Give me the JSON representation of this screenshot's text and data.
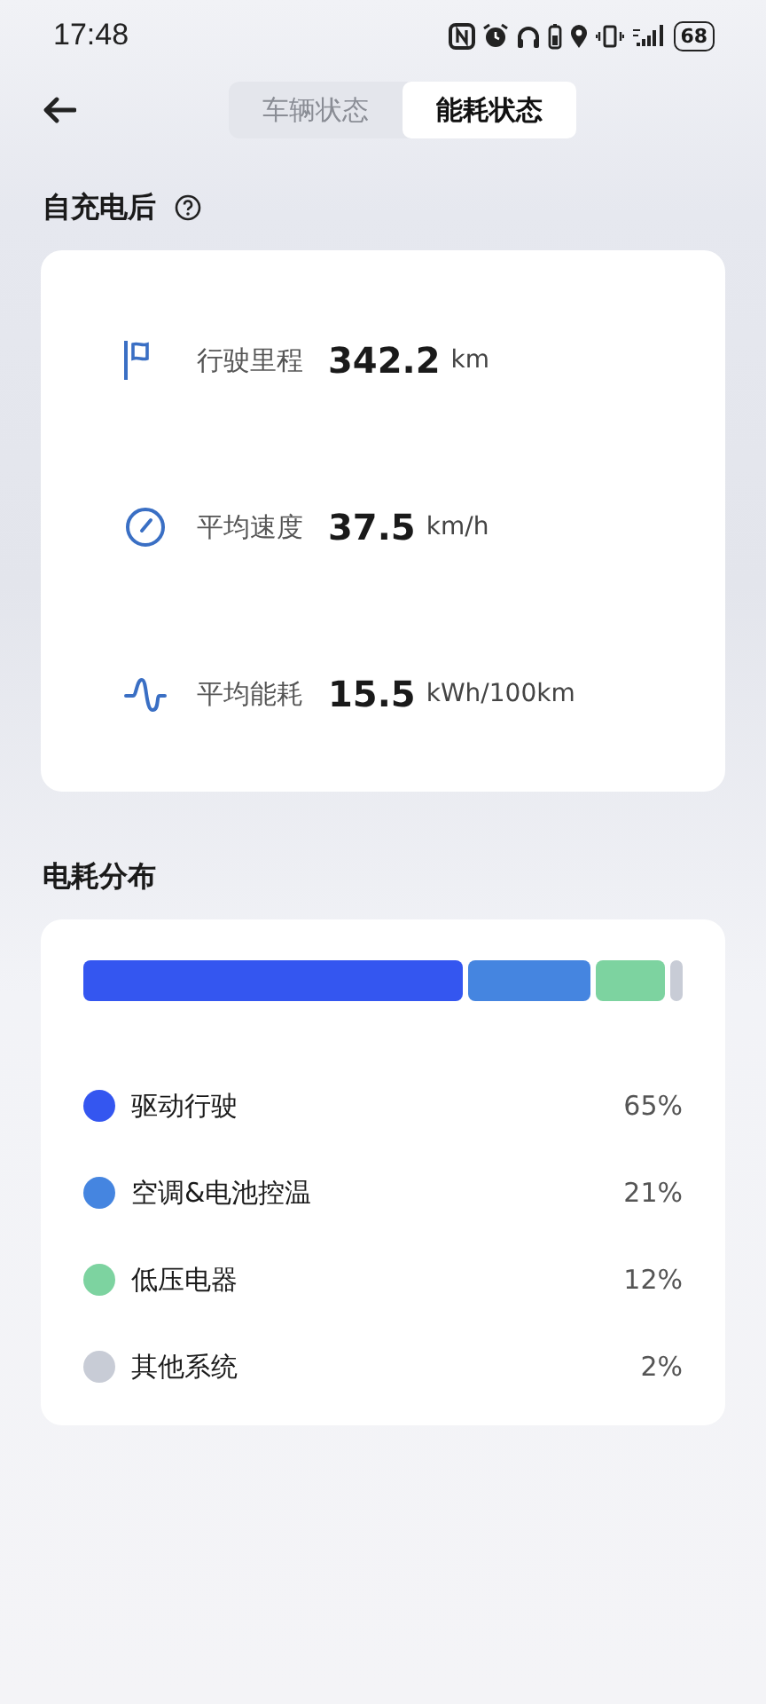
{
  "status_bar": {
    "time": "17:48",
    "battery": "68"
  },
  "tabs": [
    {
      "label": "车辆状态",
      "selected": false
    },
    {
      "label": "能耗状态",
      "selected": true
    }
  ],
  "summary": {
    "title": "自充电后",
    "stats": [
      {
        "kind": "distance",
        "label": "行驶里程",
        "value": "342.2",
        "unit": "km"
      },
      {
        "kind": "speed",
        "label": "平均速度",
        "value": "37.5",
        "unit": "km/h"
      },
      {
        "kind": "energy",
        "label": "平均能耗",
        "value": "15.5",
        "unit": "kWh/100km"
      }
    ]
  },
  "breakdown": {
    "title": "电耗分布",
    "items": [
      {
        "label": "驱动行驶",
        "percent": "65%",
        "color": "#3456f0"
      },
      {
        "label": "空调&电池控温",
        "percent": "21%",
        "color": "#4585e0"
      },
      {
        "label": "低压电器",
        "percent": "12%",
        "color": "#7dd3a0"
      },
      {
        "label": "其他系统",
        "percent": "2%",
        "color": "#c8ccd6"
      }
    ]
  }
}
